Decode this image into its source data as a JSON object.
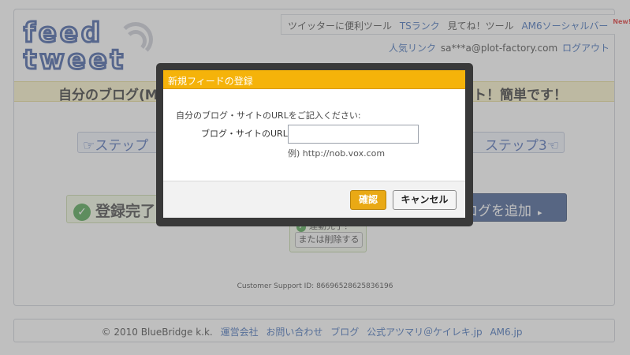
{
  "logo": {
    "line1": "feed",
    "line2": "tweet"
  },
  "topnav": {
    "items": [
      {
        "label": "ツイッターに便利ツール",
        "kind": "plain"
      },
      {
        "label": "TSランク",
        "kind": "link"
      },
      {
        "label": "見てね！ツール",
        "kind": "plain"
      },
      {
        "label": "AM6ソーシャルバー",
        "kind": "link"
      }
    ],
    "new_badge": "New!"
  },
  "usernav": {
    "popular_link": "人気リンク",
    "email": "sa***a@plot-factory.com",
    "logout_link": "ログアウト"
  },
  "banner": {
    "left_text": "自分のブログ(M",
    "right_text": "ート！簡単です！"
  },
  "steps": {
    "step1_label": "☞ステップ",
    "step3_label": "ステップ3☜"
  },
  "registration": {
    "done_label": "登録完了",
    "done_icon": "check-circle-icon"
  },
  "add_blog": {
    "label": "ログを追加",
    "arrow": "▸"
  },
  "linked": {
    "status": "連動完了！",
    "delete_label": "または削除する"
  },
  "support": {
    "text": "Customer Support ID: 86696528625836196"
  },
  "footer": {
    "copyright": "© 2010 BlueBridge k.k.",
    "links": [
      "運営会社",
      "お問い合わせ",
      "ブログ",
      "公式アツマリ＠ケイレキ.jp",
      "AM6.jp"
    ]
  },
  "dialog": {
    "title": "新規フィードの登録",
    "prompt": "自分のブログ・サイトのURLをご記入ください:",
    "field_label": "ブログ・サイトのURL",
    "url_value": "",
    "example": "例) http://nob.vox.com",
    "confirm_label": "確認",
    "cancel_label": "キャンセル"
  },
  "colors": {
    "dialog_title_bg": "#f5b30a",
    "confirm_bg": "#e9a915",
    "link": "#2a5db0",
    "add_blog_bg": "#2f4c86",
    "banner_bg": "#fbf3c5"
  }
}
